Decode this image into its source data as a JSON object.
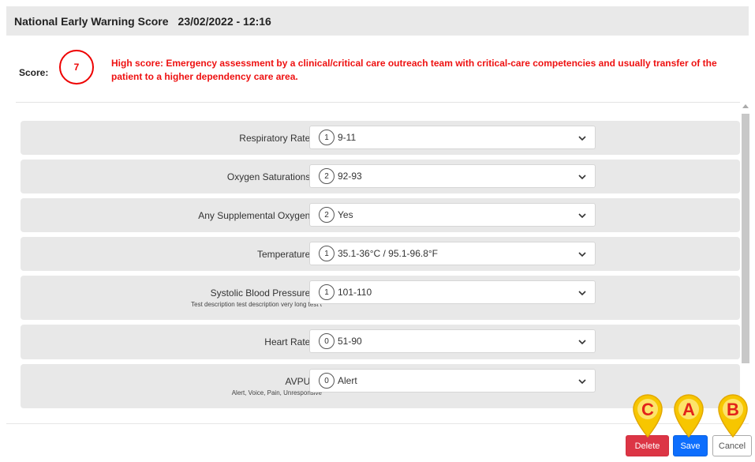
{
  "header": {
    "title": "National Early Warning Score",
    "timestamp": "23/02/2022 - 12:16"
  },
  "score": {
    "label": "Score:",
    "value": "7",
    "message": "High score: Emergency assessment by a clinical/critical care outreach team with critical-care competencies and usually transfer of the patient to a higher dependency care area.",
    "color": "#ee1111"
  },
  "fields": [
    {
      "label": "Respiratory Rate * :",
      "description": "",
      "points": "1",
      "value": "9-11"
    },
    {
      "label": "Oxygen Saturations * :",
      "description": "",
      "points": "2",
      "value": "92-93"
    },
    {
      "label": "Any Supplemental Oxygen * :",
      "description": "",
      "points": "2",
      "value": "Yes"
    },
    {
      "label": "Temperature * :",
      "description": "",
      "points": "1",
      "value": "35.1-36°C / 95.1-96.8°F"
    },
    {
      "label": "Systolic Blood Pressure * :",
      "description": "Test description test description very long test t",
      "points": "1",
      "value": "101-110"
    },
    {
      "label": "Heart Rate * :",
      "description": "",
      "points": "0",
      "value": "51-90"
    },
    {
      "label": "AVPU * :",
      "description": "Alert, Voice, Pain, Unresponsive",
      "points": "0",
      "value": "Alert"
    }
  ],
  "buttons": {
    "delete": "Delete",
    "save": "Save",
    "cancel": "Cancel"
  },
  "markers": [
    {
      "letter": "C",
      "target": "delete"
    },
    {
      "letter": "A",
      "target": "save"
    },
    {
      "letter": "B",
      "target": "cancel"
    }
  ],
  "colors": {
    "danger": "#dc3545",
    "primary": "#0d6efd",
    "marker_fill": "#f7c600",
    "marker_letter": "#e2231a"
  }
}
